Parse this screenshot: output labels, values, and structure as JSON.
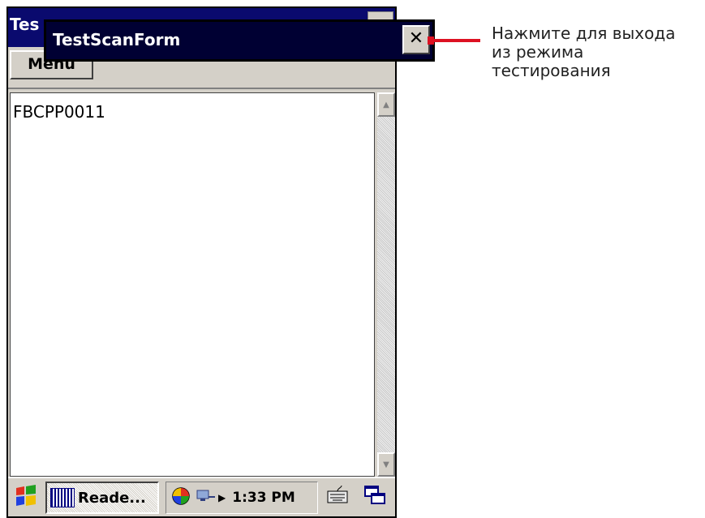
{
  "background_window": {
    "title": "Tes",
    "menu_label": "Menu"
  },
  "text_area": {
    "content": "FBCPP0011"
  },
  "popup": {
    "title": "TestScanForm",
    "close_label": "✕"
  },
  "taskbar": {
    "start_icon": "windows-flag-icon",
    "app_label": "Reade...",
    "clock": "1:33 PM",
    "tray_icons": [
      "color-wheel-icon",
      "network-icon"
    ],
    "keyboard_icon": "keyboard-icon",
    "windows_icon": "overlapping-windows-icon"
  },
  "annotation": {
    "lines": [
      "Нажмите для выхода",
      "из режима",
      "тестирования"
    ],
    "color": "#dd1122"
  },
  "colors": {
    "title_bar": "#0a0a6e",
    "window_bg": "#d4d0c8",
    "popup_bg": "#000033"
  }
}
